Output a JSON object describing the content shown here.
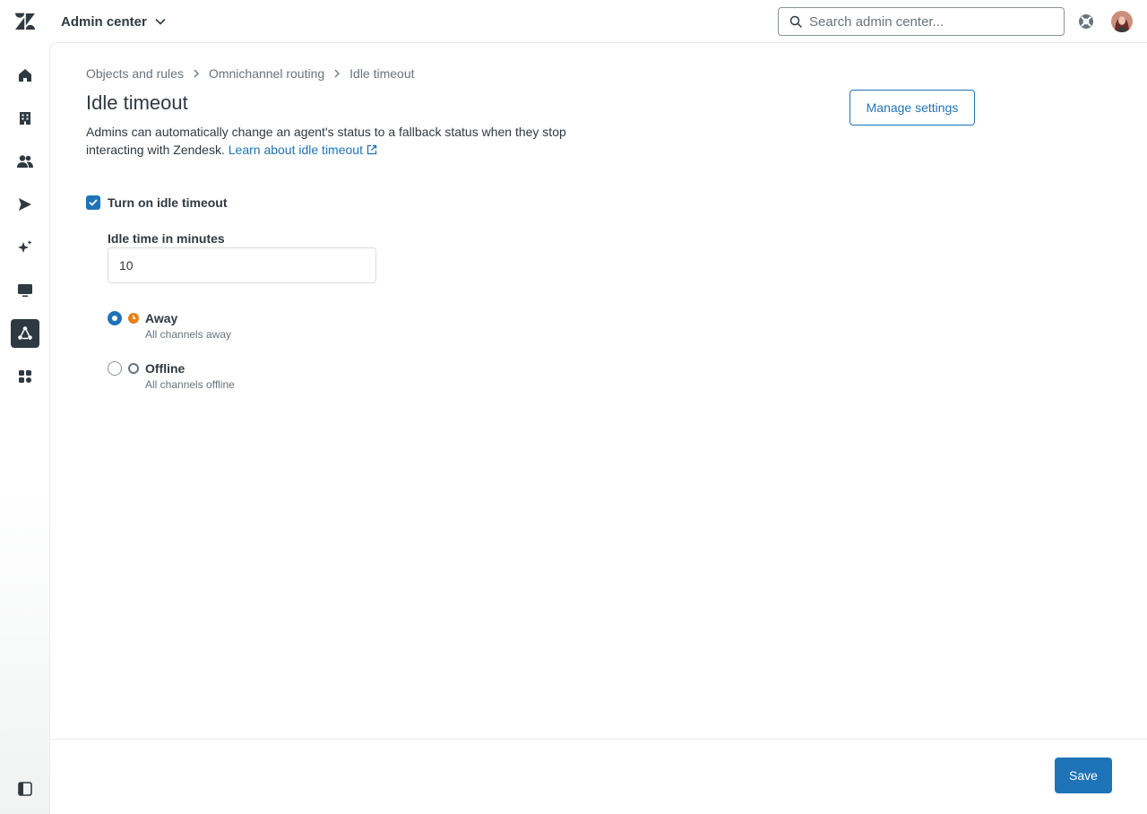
{
  "header": {
    "product_name": "Admin center",
    "search_placeholder": "Search admin center...",
    "icons": [
      "zendesk-logo",
      "chevron-down-icon",
      "search-icon",
      "help-icon",
      "avatar"
    ]
  },
  "sidenav": {
    "items": [
      {
        "name": "home",
        "icon": "home-icon",
        "active": false
      },
      {
        "name": "account",
        "icon": "building-icon",
        "active": false
      },
      {
        "name": "people",
        "icon": "people-icon",
        "active": false
      },
      {
        "name": "channels",
        "icon": "send-icon",
        "active": false
      },
      {
        "name": "ai",
        "icon": "sparkle-icon",
        "active": false
      },
      {
        "name": "workspaces",
        "icon": "monitor-icon",
        "active": false
      },
      {
        "name": "objects-and-rules",
        "icon": "objects-rules-icon",
        "active": true
      },
      {
        "name": "apps-and-integrations",
        "icon": "apps-icon",
        "active": false
      }
    ]
  },
  "breadcrumb": [
    "Objects and rules",
    "Omnichannel routing",
    "Idle timeout"
  ],
  "page": {
    "title": "Idle timeout",
    "description": "Admins can automatically change an agent's status to a fallback status when they stop interacting with Zendesk.",
    "learn_link": "Learn about idle timeout",
    "manage_button": "Manage settings"
  },
  "form": {
    "checkbox_label": "Turn on idle timeout",
    "checkbox_checked": true,
    "idle_label": "Idle time in minutes",
    "idle_value": "10",
    "options": [
      {
        "title": "Away",
        "subtitle": "All channels away",
        "selected": true,
        "status_color": "#e38215"
      },
      {
        "title": "Offline",
        "subtitle": "All channels offline",
        "selected": false,
        "status_color": "#68737d"
      }
    ]
  },
  "footer": {
    "save_label": "Save"
  },
  "colors": {
    "accent": "#1f73b7",
    "nav_active": "#2f3941",
    "away": "#e38215"
  }
}
